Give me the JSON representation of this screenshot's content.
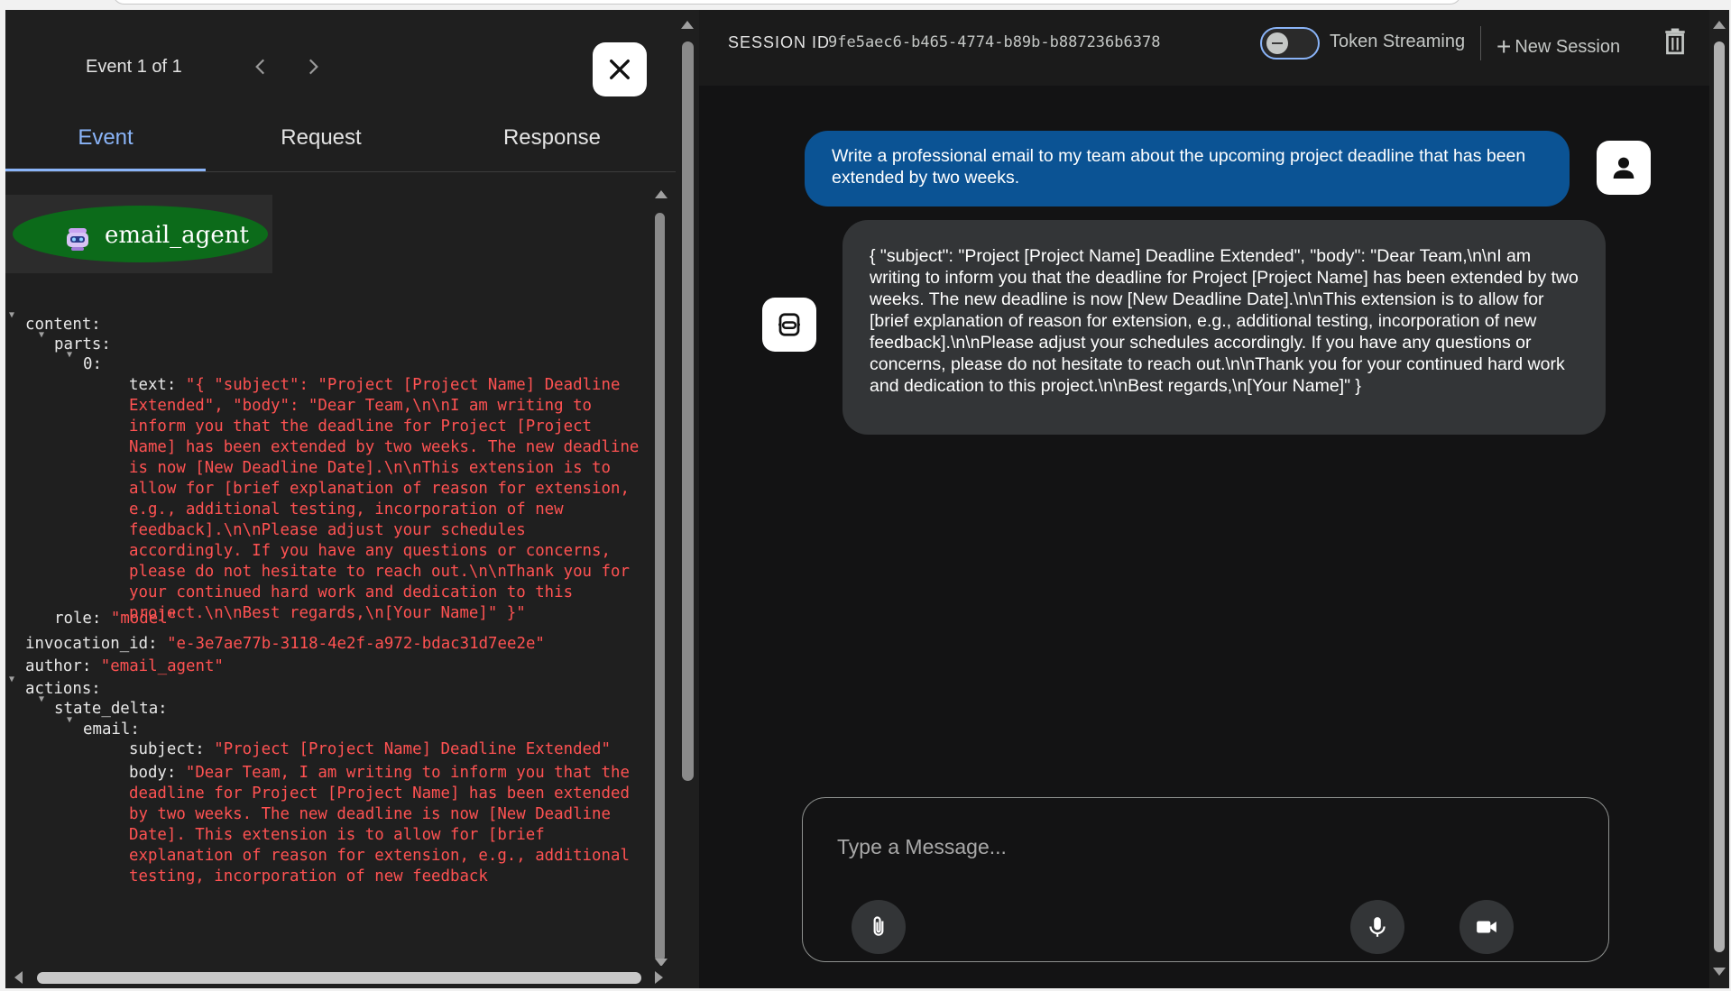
{
  "event_panel": {
    "counter": "Event 1 of 1",
    "prev_icon": "chevron-left-icon",
    "next_icon": "chevron-right-icon",
    "close_icon": "close-icon",
    "tabs": [
      {
        "label": "Event",
        "active": true
      },
      {
        "label": "Request",
        "active": false
      },
      {
        "label": "Response",
        "active": false
      }
    ],
    "agent_badge": "email_agent",
    "tree": {
      "content_key": "content:",
      "parts_key": "parts:",
      "index_key": "0:",
      "text_key": "text:",
      "text_value": "\"{ \"subject\": \"Project [Project Name] Deadline Extended\", \"body\": \"Dear Team,\\n\\nI am writing to inform you that the deadline for Project [Project Name] has been extended by two weeks. The new deadline is now [New Deadline Date].\\n\\nThis extension is to allow for [brief explanation of reason for extension, e.g., additional testing, incorporation of new feedback].\\n\\nPlease adjust your schedules accordingly. If you have any questions or concerns, please do not hesitate to reach out.\\n\\nThank you for your continued hard work and dedication to this project.\\n\\nBest regards,\\n[Your Name]\" }\"",
      "role_key": "role:",
      "role_value": "\"model\"",
      "invocation_key": "invocation_id:",
      "invocation_value": "\"e-3e7ae77b-3118-4e2f-a972-bdac31d7ee2e\"",
      "author_key": "author:",
      "author_value": "\"email_agent\"",
      "actions_key": "actions:",
      "state_delta_key": "state_delta:",
      "email_key": "email:",
      "subject_key": "subject:",
      "subject_value": "\"Project [Project Name] Deadline Extended\"",
      "body_key": "body:",
      "body_value": "\"Dear Team, I am writing to inform you that the deadline for Project [Project Name] has been extended by two weeks. The new deadline is now [New Deadline Date]. This extension is to allow for [brief explanation of reason for extension, e.g., additional testing, incorporation of new feedback"
    }
  },
  "session_bar": {
    "label": "SESSION ID",
    "id": "9fe5aec6-b465-4774-b89b-b887236b6378",
    "toggle_label": "Token Streaming",
    "new_session_label": "New Session",
    "trash_icon": "trash-icon"
  },
  "chat": {
    "user_message": "Write a professional email to my team about the upcoming project deadline that has been extended by two weeks.",
    "bot_message": "{ \"subject\": \"Project [Project Name] Deadline Extended\", \"body\": \"Dear Team,\\n\\nI am writing to inform you that the deadline for Project [Project Name] has been extended by two weeks. The new deadline is now [New Deadline Date].\\n\\nThis extension is to allow for [brief explanation of reason for extension, e.g., additional testing, incorporation of new feedback].\\n\\nPlease adjust your schedules accordingly. If you have any questions or concerns, please do not hesitate to reach out.\\n\\nThank you for your continued hard work and dedication to this project.\\n\\nBest regards,\\n[Your Name]\" }",
    "user_avatar_icon": "person-icon",
    "bot_avatar_icon": "robot-icon"
  },
  "composer": {
    "placeholder": "Type a Message...",
    "attach_icon": "paperclip-icon",
    "mic_icon": "microphone-icon",
    "video_icon": "video-camera-icon"
  },
  "colors": {
    "accent": "#8ab4f8",
    "user_bubble": "#0b5394",
    "bot_bubble": "#333537",
    "json_value": "#ff5252",
    "agent_badge": "#0c6b1a"
  }
}
